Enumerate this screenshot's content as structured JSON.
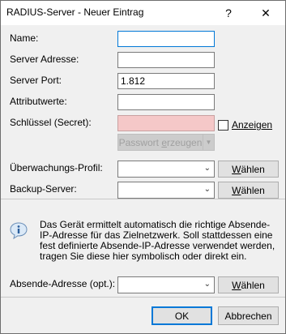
{
  "window": {
    "title": "RADIUS-Server - Neuer Eintrag",
    "help_glyph": "?",
    "close_glyph": "✕"
  },
  "form": {
    "name_label": "Name:",
    "name_value": "",
    "server_address_label": "Server Adresse:",
    "server_address_value": "",
    "server_port_label": "Server Port:",
    "server_port_value": "1.812",
    "attribute_values_label": "Attributwerte:",
    "attribute_values_value": "",
    "secret_label": "Schlüssel (Secret):",
    "secret_value": "",
    "show_checkbox_label": "Anzeigen",
    "show_checkbox_checked": false,
    "generate_password_button": "Passwort erzeugen",
    "monitoring_profile_label": "Überwachungs-Profil:",
    "monitoring_profile_value": "",
    "monitoring_profile_choose": "Wählen",
    "backup_server_label": "Backup-Server:",
    "backup_server_value": "",
    "backup_server_choose": "Wählen"
  },
  "info": {
    "icon": "info-speech-bubble-icon",
    "text": "Das Gerät ermittelt automatisch die richtige Absende-IP-Adresse für das Zielnetzwerk. Soll stattdessen eine fest definierte Absende-IP-Adresse verwendet werden, tragen Sie diese hier symbolisch oder direkt ein."
  },
  "source_address": {
    "label": "Absende-Adresse (opt.):",
    "value": "",
    "choose": "Wählen"
  },
  "footer": {
    "ok": "OK",
    "cancel": "Abbrechen"
  },
  "colors": {
    "accent": "#0078d7",
    "secret_bg": "#f5c8c8",
    "dialog_bg": "#f0f0f0"
  }
}
